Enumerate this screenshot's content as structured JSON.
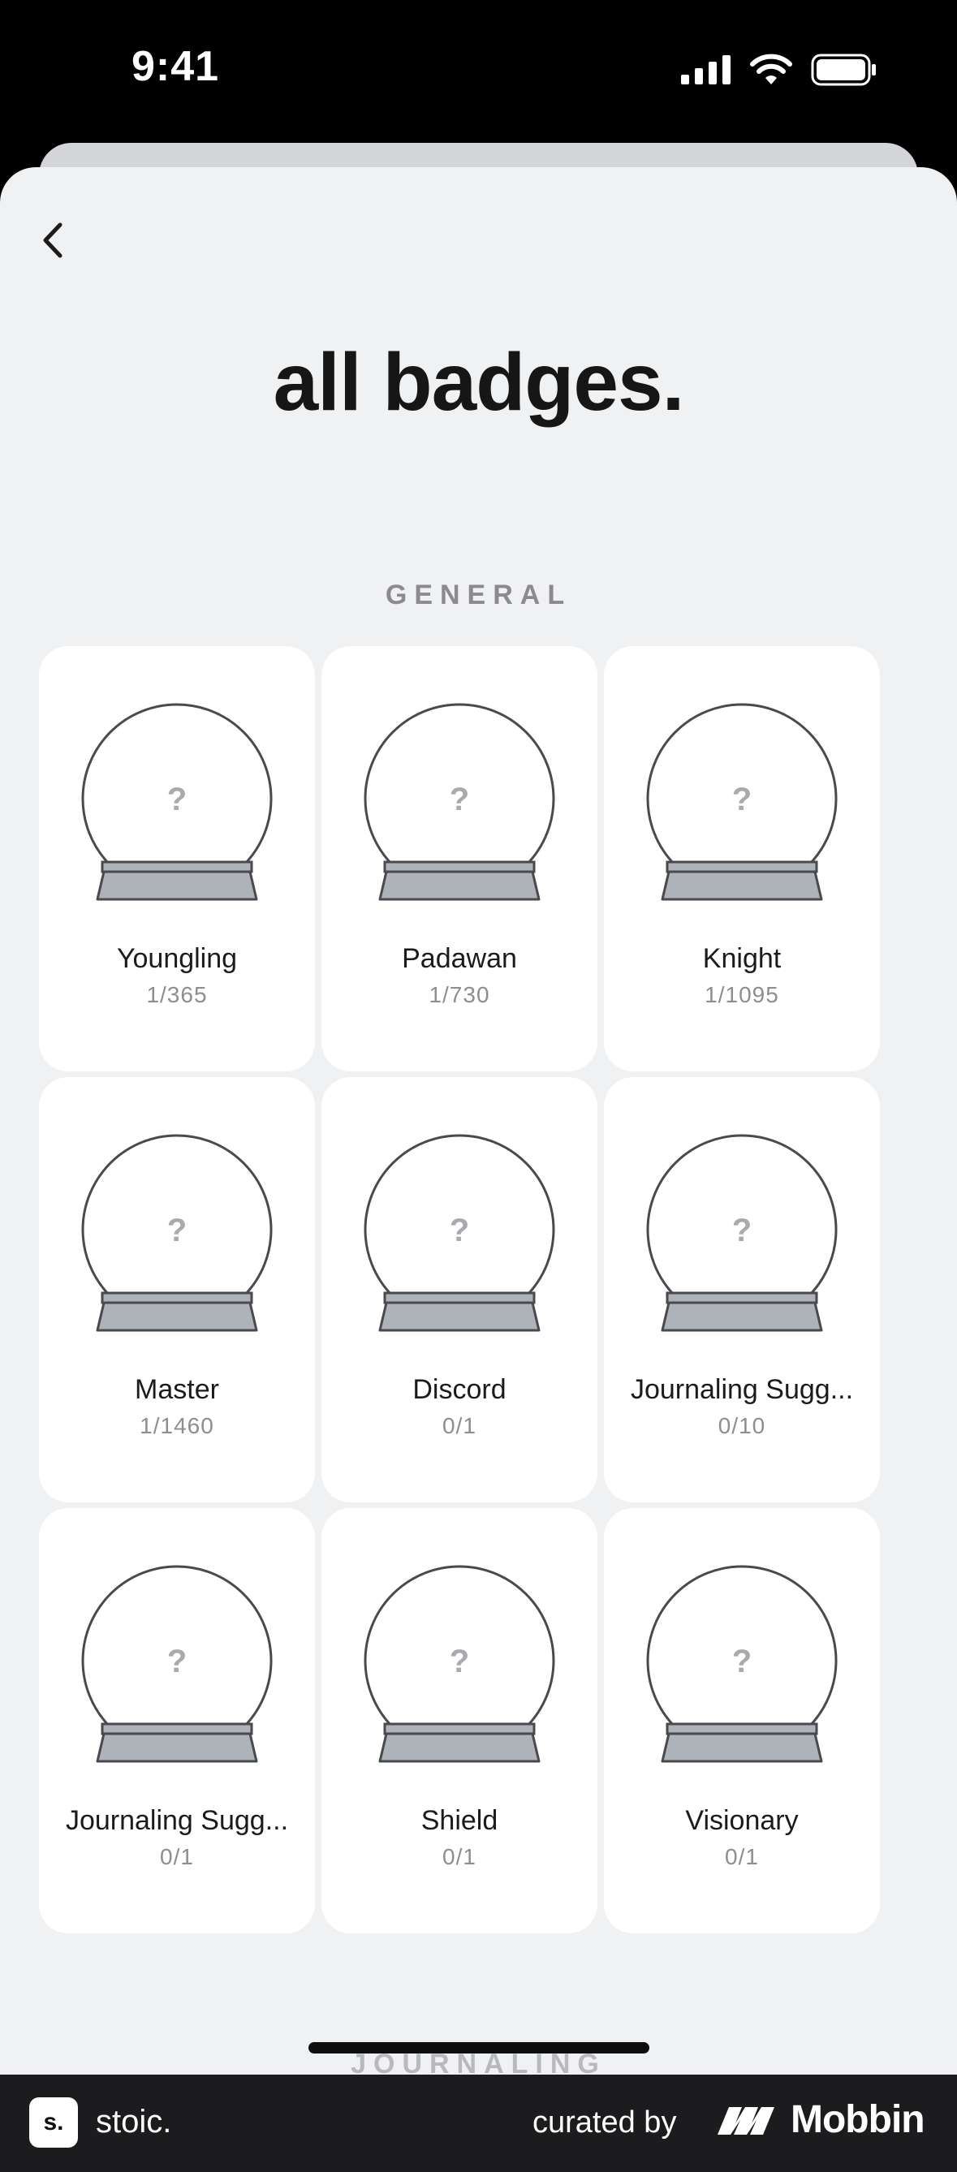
{
  "status_bar": {
    "time": "9:41"
  },
  "header": {
    "title": "all badges."
  },
  "section": {
    "label": "GENERAL"
  },
  "badges": [
    {
      "name": "Youngling",
      "progress": "1/365"
    },
    {
      "name": "Padawan",
      "progress": "1/730"
    },
    {
      "name": "Knight",
      "progress": "1/1095"
    },
    {
      "name": "Master",
      "progress": "1/1460"
    },
    {
      "name": "Discord",
      "progress": "0/1"
    },
    {
      "name": "Journaling Sugg...",
      "progress": "0/10"
    },
    {
      "name": "Journaling Sugg...",
      "progress": "0/1"
    },
    {
      "name": "Shield",
      "progress": "0/1"
    },
    {
      "name": "Visionary",
      "progress": "0/1"
    }
  ],
  "badge_placeholder": "?",
  "next_section_partial": "JOURNALING",
  "footer": {
    "logo_text": "s.",
    "app_name": "stoic.",
    "curated_by": "curated by",
    "brand": "Mobbin"
  },
  "colors": {
    "sheet_bg": "#f0f1f3",
    "card_bg": "#ffffff",
    "globe_base": "#aeb3ba",
    "footer_bg": "#1c1c1e"
  }
}
